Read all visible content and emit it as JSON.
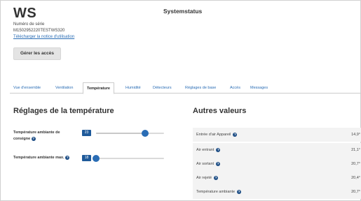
{
  "header": {
    "device_name": "WS",
    "system_title": "Systemstatus",
    "serial_label": "Numéro de série",
    "serial_value": "M1502952220TESTWS320",
    "manual_link": "Télécharger la notice d'utilisation",
    "access_button": "Gérer les accès"
  },
  "tabs": [
    {
      "label": "Vue d'ensemble"
    },
    {
      "label": "Ventilation"
    },
    {
      "label": "Température",
      "active": true
    },
    {
      "label": "Humidité"
    },
    {
      "label": "Détecteurs"
    },
    {
      "label": "Réglages de base"
    },
    {
      "label": "Accès"
    },
    {
      "label": "Messages"
    }
  ],
  "settings": {
    "title": "Réglages de la température",
    "items": [
      {
        "label_line1": "Température ambiante de",
        "label_line2": "consigne",
        "value": "23",
        "level": 0.72
      },
      {
        "label_line1": "Température ambiante max.",
        "value": "18",
        "level": 0.0
      }
    ]
  },
  "other_values": {
    "title": "Autres valeurs",
    "rows": [
      {
        "label": "Entrée d'air Appareil",
        "value": "14,9°",
        "help": true
      },
      {
        "label": "Air entrant",
        "value": "21,1°",
        "help": true
      },
      {
        "label": "Air sortant",
        "value": "20,7°",
        "help": true
      },
      {
        "label": "Air rejeté",
        "value": "20,4°",
        "help": true
      },
      {
        "label": "Température ambiante",
        "value": "20,7°",
        "help": true
      }
    ]
  },
  "icons": {
    "help": "question-circle-icon"
  },
  "colors": {
    "accent": "#2a6db5",
    "badge": "#1f5a9a",
    "help_icon": "#1f4f86",
    "link": "#2a6db5"
  }
}
